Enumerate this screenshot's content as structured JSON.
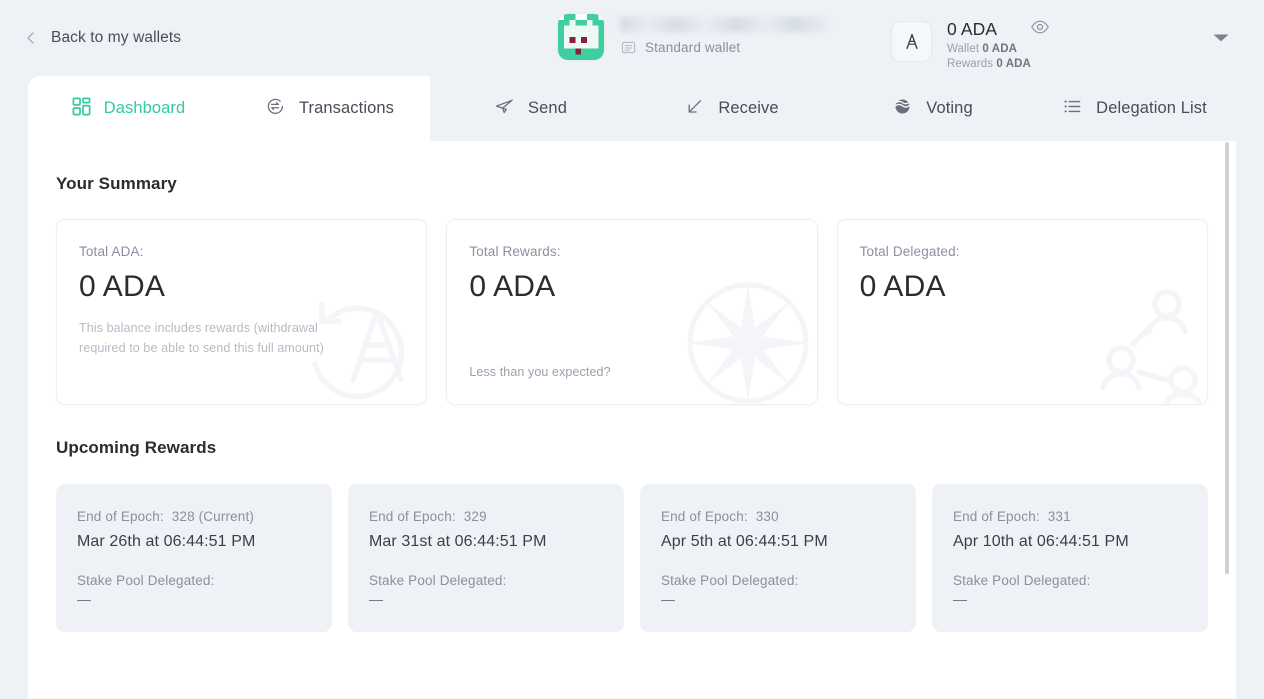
{
  "topbar": {
    "back_label": "Back to my wallets",
    "back_icon": "chevron-left-icon",
    "wallet": {
      "name": "",
      "name_redacted": true,
      "type_label": "Standard wallet",
      "type_icon": "wallet-card-icon",
      "avatar_icon": "pixel-identicon-avatar",
      "avatar_colors": {
        "base": "#3ecfa0",
        "face": "#eef8f4",
        "detail": "#8b1f38",
        "background": "#ffffff"
      }
    },
    "balance": {
      "total": "0 ADA",
      "wallet_label": "Wallet",
      "wallet_amount": "0 ADA",
      "rewards_label": "Rewards",
      "rewards_amount": "0 ADA",
      "currency_icon": "ada-symbol-icon",
      "visibility_icon": "eye-icon"
    },
    "menu_caret_icon": "caret-down-icon"
  },
  "tabs": [
    {
      "label": "Dashboard",
      "icon": "grid-icon",
      "active": true
    },
    {
      "label": "Transactions",
      "icon": "exchange-icon",
      "active": false
    },
    {
      "label": "Send",
      "icon": "paper-plane-icon",
      "active": false
    },
    {
      "label": "Receive",
      "icon": "arrow-down-left-icon",
      "active": false
    },
    {
      "label": "Voting",
      "icon": "ballot-icon",
      "active": false
    },
    {
      "label": "Delegation List",
      "icon": "list-icon",
      "active": false
    }
  ],
  "summary": {
    "title": "Your Summary",
    "cards": [
      {
        "label": "Total ADA:",
        "value": "0 ADA",
        "note": "This balance includes rewards (withdrawal required to be able to send this full amount)",
        "watermark_icon": "ada-refresh-watermark-icon"
      },
      {
        "label": "Total Rewards:",
        "value": "0 ADA",
        "note_bottom": "Less than you expected?",
        "watermark_icon": "compass-star-watermark-icon"
      },
      {
        "label": "Total Delegated:",
        "value": "0 ADA",
        "watermark_icon": "people-network-watermark-icon"
      }
    ]
  },
  "upcoming": {
    "title": "Upcoming Rewards",
    "epoch_label": "End of Epoch:",
    "pool_label": "Stake Pool Delegated:",
    "cards": [
      {
        "epoch": "328 (Current)",
        "date": "Mar 26th at 06:44:51 PM",
        "pool": "—"
      },
      {
        "epoch": "329",
        "date": "Mar 31st at 06:44:51 PM",
        "pool": "—"
      },
      {
        "epoch": "330",
        "date": "Apr 5th at 06:44:51 PM",
        "pool": "—"
      },
      {
        "epoch": "331",
        "date": "Apr 10th at 06:44:51 PM",
        "pool": "—"
      }
    ]
  },
  "theme": {
    "accent": "#33c9a2",
    "page_background": "#eef1f5",
    "panel_background": "#ffffff",
    "text_primary": "#2b2c32",
    "text_muted": "#8a909e"
  }
}
